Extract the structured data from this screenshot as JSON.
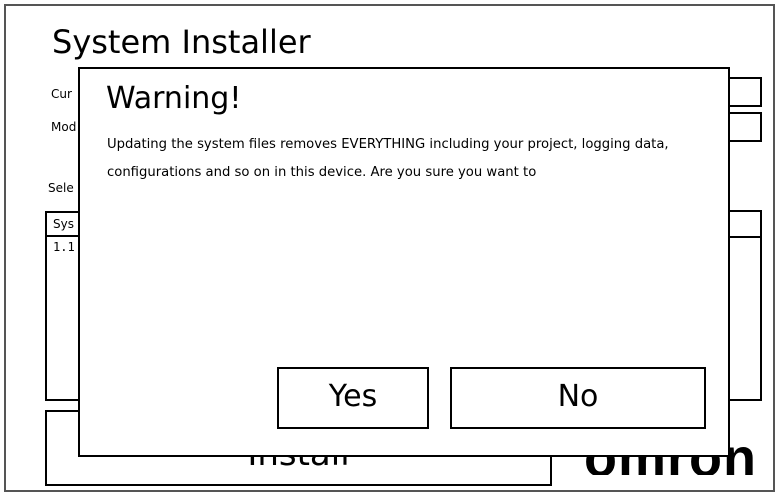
{
  "app": {
    "title": "System Installer"
  },
  "background": {
    "label_current": "Cur",
    "label_model": "Mod",
    "label_select": "Sele",
    "list_header": "Sys",
    "list_items": [
      "1.1"
    ],
    "install_label": "Install",
    "logo_text": "omron"
  },
  "dialog": {
    "title": "Warning!",
    "message": "Updating the system files removes EVERYTHING including your project, logging data, configurations and so on in this device. Are you sure you want to",
    "yes_label": "Yes",
    "no_label": "No"
  }
}
